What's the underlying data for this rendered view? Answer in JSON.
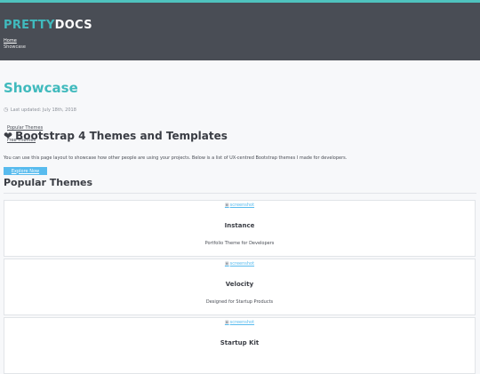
{
  "header": {
    "brand_part1": "PRETTY",
    "brand_part2": "DOCS",
    "breadcrumb_home": "Home",
    "breadcrumb_current": "Showcase"
  },
  "page": {
    "title": "Showcase",
    "updated": "Last updated: July 18th, 2018"
  },
  "dropdown": {
    "item1": "Popular Themes",
    "item2": "Free Themes"
  },
  "section": {
    "heading": "Bootstrap 4 Themes and Templates",
    "intro": "You can use this page layout to showcase how other people are using your projects. Below is a list of UX-centred Bootstrap themes I made for developers.",
    "button": "Explore Now",
    "subheading": "Popular Themes"
  },
  "cards": [
    {
      "image_alt": "screenshot",
      "name": "Instance",
      "desc": "Portfolio Theme for Developers"
    },
    {
      "image_alt": "screenshot",
      "name": "Velocity",
      "desc": "Designed for Startup Products"
    },
    {
      "image_alt": "screenshot",
      "name": "Startup Kit",
      "desc": ""
    }
  ],
  "colors": {
    "header_bg": "#494d55",
    "accent": "#40babd",
    "button": "#58bbee"
  },
  "icons": [
    "clock-icon",
    "heart-icon",
    "image-icon"
  ]
}
